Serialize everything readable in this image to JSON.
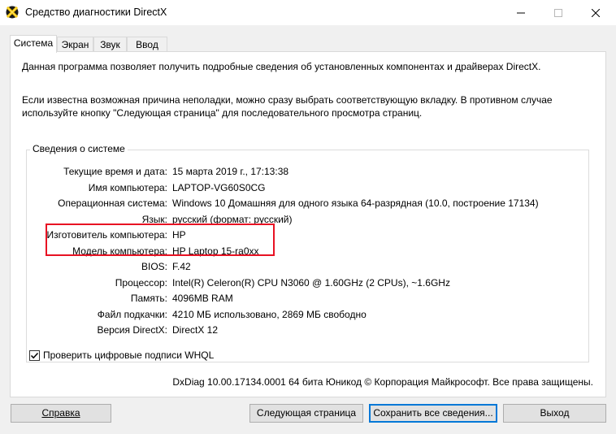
{
  "window": {
    "title": "Средство диагностики DirectX"
  },
  "tabs": [
    {
      "label": "Система",
      "active": true
    },
    {
      "label": "Экран"
    },
    {
      "label": "Звук"
    },
    {
      "label": "Ввод"
    }
  ],
  "intro": {
    "line1": "Данная программа позволяет получить подробные сведения об установленных компонентах и драйверах DirectX.",
    "line2": "Если известна возможная причина неполадки, можно сразу выбрать соответствующую вкладку. В противном случае используйте кнопку \"Следующая страница\" для последовательного просмотра страниц."
  },
  "sysinfo": {
    "group_title": "Сведения о системе",
    "rows": [
      {
        "label": "Текущие время и дата:",
        "value": "15 марта 2019 г., 17:13:38"
      },
      {
        "label": "Имя компьютера:",
        "value": "LAPTOP-VG60S0CG"
      },
      {
        "label": "Операционная система:",
        "value": "Windows 10 Домашняя для одного языка 64-разрядная (10.0, построение 17134)"
      },
      {
        "label": "Язык:",
        "value": "русский (формат: русский)"
      },
      {
        "label": "Изготовитель компьютера:",
        "value": "HP"
      },
      {
        "label": "Модель компьютера:",
        "value": "HP Laptop 15-ra0xx"
      },
      {
        "label": "BIOS:",
        "value": "F.42"
      },
      {
        "label": "Процессор:",
        "value": "Intel(R) Celeron(R) CPU  N3060  @ 1.60GHz (2 CPUs), ~1.6GHz"
      },
      {
        "label": "Память:",
        "value": "4096MB RAM"
      },
      {
        "label": "Файл подкачки:",
        "value": "4210 МБ использовано, 2869 МБ свободно"
      },
      {
        "label": "Версия DirectX:",
        "value": "DirectX 12"
      }
    ]
  },
  "whql_checkbox": {
    "label": "Проверить цифровые подписи WHQL",
    "checked": true
  },
  "footer_text": "DxDiag 10.00.17134.0001 64 бита Юникод  © Корпорация Майкрософт. Все права защищены.",
  "buttons": {
    "help": "Справка",
    "next": "Следующая страница",
    "save": "Сохранить все сведения...",
    "exit": "Выход"
  }
}
